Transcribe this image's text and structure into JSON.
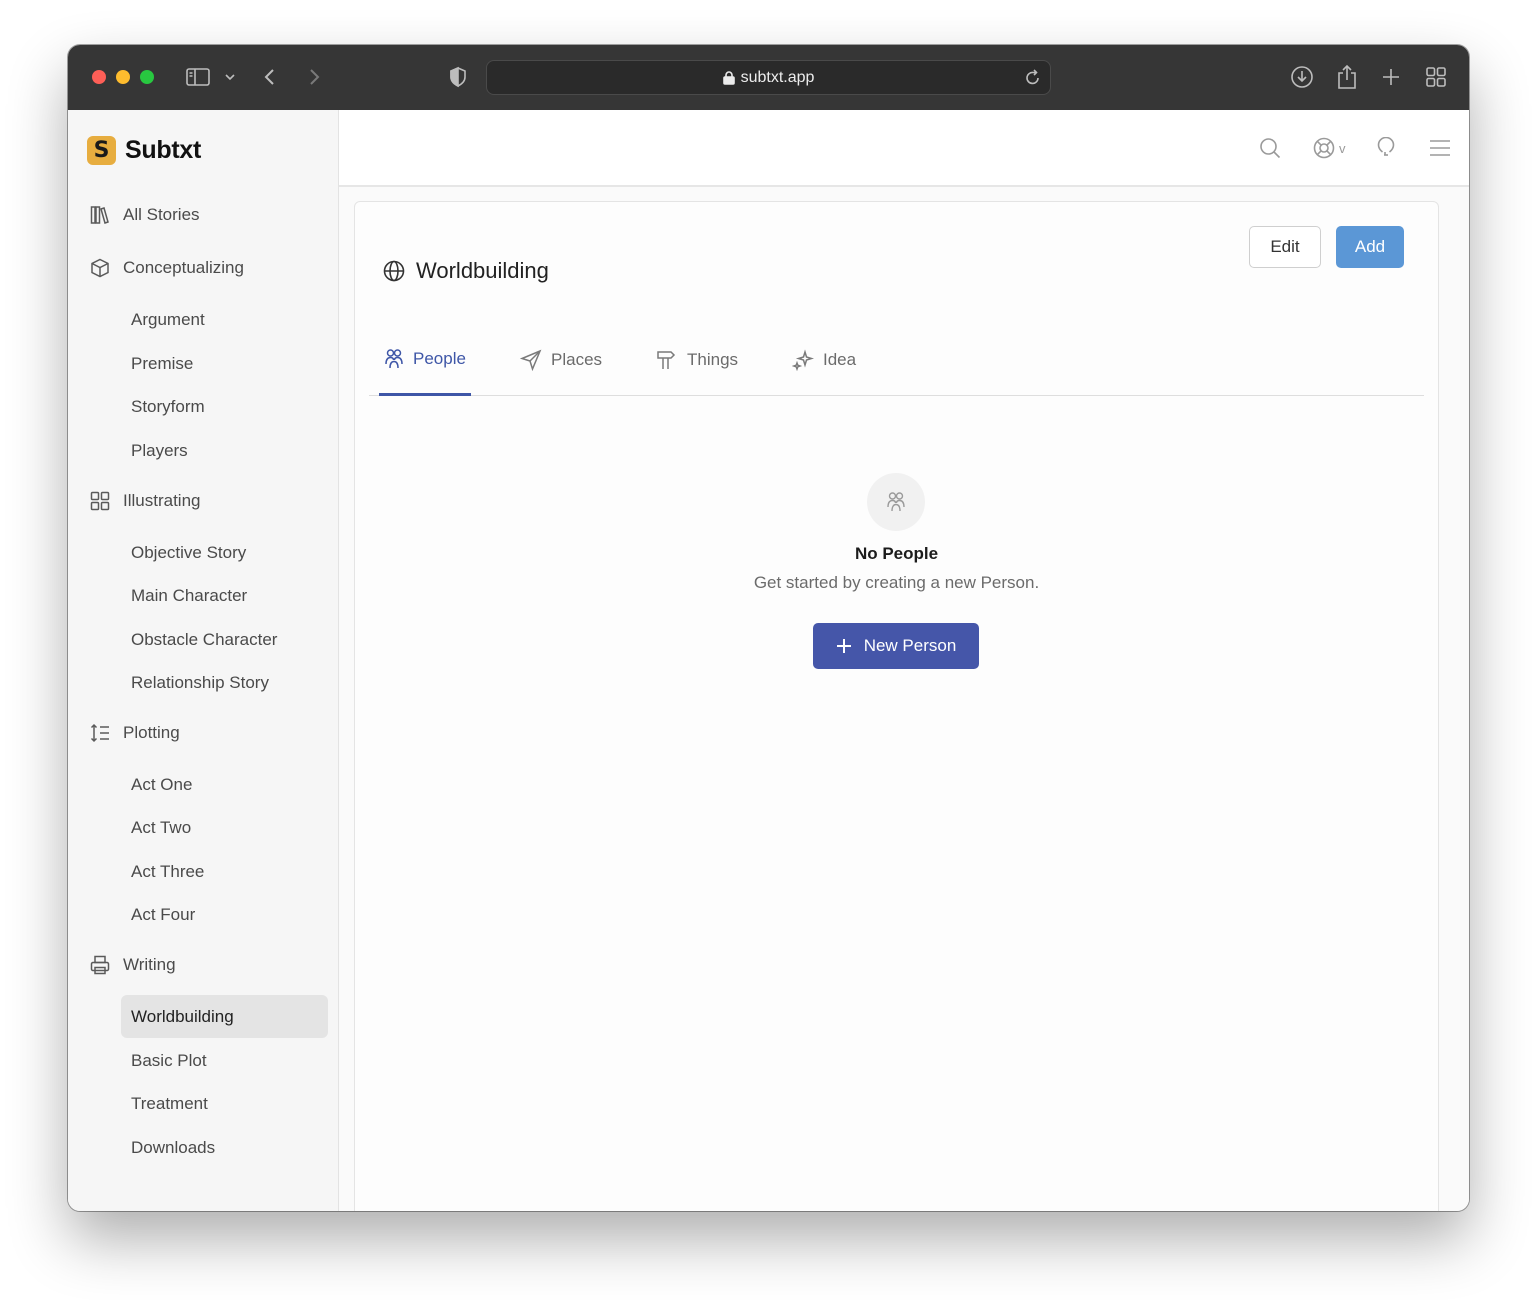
{
  "browser": {
    "url": "subtxt.app"
  },
  "app": {
    "name": "Subtxt",
    "logo_letter": "S"
  },
  "sidebar": {
    "all_stories": "All Stories",
    "sections": [
      {
        "label": "Conceptualizing",
        "icon": "cube-icon",
        "items": [
          "Argument",
          "Premise",
          "Storyform",
          "Players"
        ]
      },
      {
        "label": "Illustrating",
        "icon": "grid-icon",
        "items": [
          "Objective Story",
          "Main Character",
          "Obstacle Character",
          "Relationship Story"
        ]
      },
      {
        "label": "Plotting",
        "icon": "sort-list-icon",
        "items": [
          "Act One",
          "Act Two",
          "Act Three",
          "Act Four"
        ]
      },
      {
        "label": "Writing",
        "icon": "printer-icon",
        "items": [
          "Worldbuilding",
          "Basic Plot",
          "Treatment",
          "Downloads"
        ]
      }
    ],
    "active_item": "Worldbuilding"
  },
  "page": {
    "title": "Worldbuilding",
    "edit_label": "Edit",
    "add_label": "Add",
    "tabs": [
      {
        "label": "People",
        "icon": "people-icon",
        "active": true
      },
      {
        "label": "Places",
        "icon": "navigation-icon",
        "active": false
      },
      {
        "label": "Things",
        "icon": "signpost-icon",
        "active": false
      },
      {
        "label": "Idea",
        "icon": "sparkles-icon",
        "active": false
      }
    ],
    "empty_state": {
      "title": "No People",
      "subtitle": "Get started by creating a new Person.",
      "button_label": "New Person"
    }
  },
  "colors": {
    "accent": "#3e56a7",
    "primary_button": "#4556a9",
    "add_button": "#5b97d6",
    "logo": "#e7ad3f"
  }
}
